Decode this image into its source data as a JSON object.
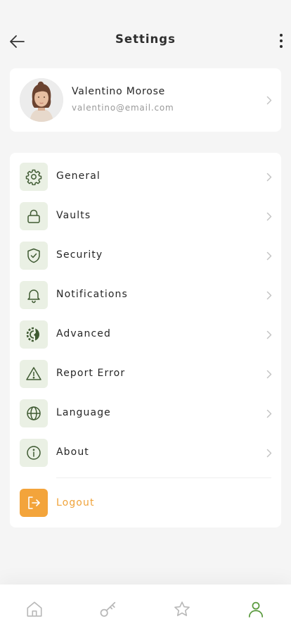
{
  "header": {
    "title": "Settings",
    "back_icon": "arrow-left-icon",
    "more_icon": "more-vertical-icon"
  },
  "profile": {
    "name": "Valentino Morose",
    "email": "valentino@email.com"
  },
  "menu": [
    {
      "label": "General",
      "icon": "gear-icon"
    },
    {
      "label": "Vaults",
      "icon": "lock-icon"
    },
    {
      "label": "Security",
      "icon": "shield-check-icon"
    },
    {
      "label": "Notifications",
      "icon": "bell-icon"
    },
    {
      "label": "Advanced",
      "icon": "advanced-gear-icon"
    },
    {
      "label": "Report Error",
      "icon": "warning-icon"
    },
    {
      "label": "Language",
      "icon": "globe-icon"
    },
    {
      "label": "About",
      "icon": "info-icon"
    }
  ],
  "logout": {
    "label": "Logout",
    "icon": "logout-icon"
  },
  "tabs": [
    {
      "name": "home",
      "icon": "home-icon",
      "active": false
    },
    {
      "name": "keys",
      "icon": "key-icon",
      "active": false
    },
    {
      "name": "favorites",
      "icon": "star-icon",
      "active": false
    },
    {
      "name": "profile",
      "icon": "user-icon",
      "active": true
    }
  ],
  "colors": {
    "accent_green": "#4a6a3a",
    "icon_bg": "#eaf0e4",
    "logout_orange": "#f3a43b",
    "active_tab": "#5a9a3e",
    "inactive_tab": "#b8b8b8"
  }
}
